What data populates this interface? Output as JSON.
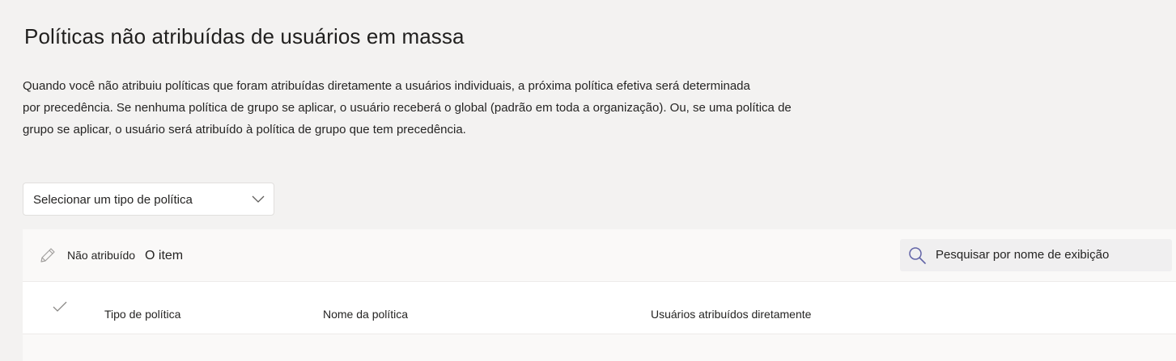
{
  "page": {
    "title": "Políticas não atribuídas de usuários em massa",
    "description_lines": [
      "Quando você não atribuiu políticas que foram atribuídas diretamente a usuários individuais, a próxima política efetiva será determinada",
      "por precedência. Se nenhuma política de grupo se aplicar, o usuário receberá o global (padrão em toda a organização). Ou, se uma política de",
      "grupo se aplicar, o usuário será atribuído à política de grupo que tem precedência."
    ]
  },
  "policy_select": {
    "value": "Selecionar um tipo de política",
    "icon": "chevron-down-icon"
  },
  "toolbar": {
    "unassign_label": "Não atribuído",
    "unassign_icon": "pencil-icon",
    "item_count": "O item",
    "search_placeholder": "Pesquisar por nome de exibição",
    "search_icon": "search-icon"
  },
  "table": {
    "columns": [
      "Tipo de política",
      "Nome da política",
      "Usuários atribuídos diretamente"
    ],
    "select_all_icon": "checkmark-icon"
  }
}
